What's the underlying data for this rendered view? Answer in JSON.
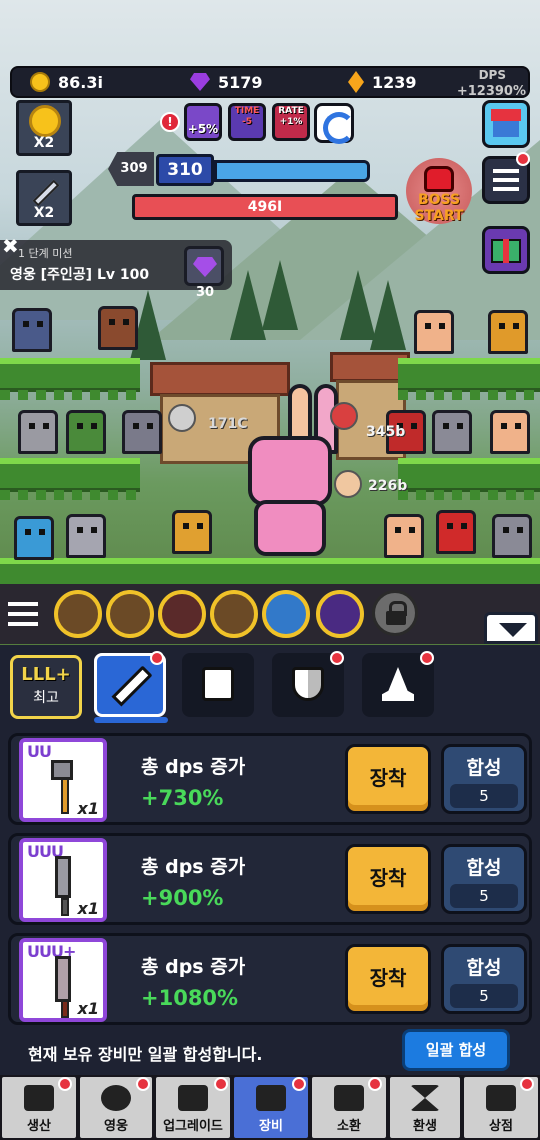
{
  "resources": {
    "coins": "86.3i",
    "gems": "5179",
    "gold": "1239",
    "dps_label": "DPS",
    "dps_value": "+12390%"
  },
  "side_buttons": {
    "coin_boost": "X2",
    "attack_boost": "X2"
  },
  "buffs": [
    {
      "label": "+5%",
      "icon": "sword-buff-icon"
    },
    {
      "label": "TIME -5",
      "icon": "time-buff-icon"
    },
    {
      "label": "RATE +1%",
      "icon": "rate-buff-icon"
    }
  ],
  "stage": {
    "previous": "309",
    "current": "310",
    "progress": 1.0
  },
  "enemy_hp": "496I",
  "boss_button": {
    "line1": "BOSS",
    "line2": "START"
  },
  "mission": {
    "subtitle": "1 단계 미션",
    "text": "영웅 [주인공] Lv 100",
    "reward": "30"
  },
  "damage_numbers": [
    "171C",
    "345b",
    "226b"
  ],
  "equipment": {
    "grade": {
      "label": "LLL+",
      "sub": "최고"
    },
    "categories": [
      "sword-icon",
      "armor-icon",
      "shield-icon",
      "hat-icon"
    ],
    "items": [
      {
        "tier": "UU",
        "qty": "x1",
        "title": "총 dps 증가",
        "value": "+730%",
        "equip": "장착",
        "merge": "합성",
        "merge_count": "5"
      },
      {
        "tier": "UUU",
        "qty": "x1",
        "title": "총 dps 증가",
        "value": "+900%",
        "equip": "장착",
        "merge": "합성",
        "merge_count": "5"
      },
      {
        "tier": "UUU+",
        "qty": "x1",
        "title": "총 dps 증가",
        "value": "+1080%",
        "equip": "장착",
        "merge": "합성",
        "merge_count": "5"
      }
    ],
    "footer_text": "현재 보유 장비만 일괄 합성합니다.",
    "bulk_button": "일괄 합성"
  },
  "nav": [
    {
      "label": "생산",
      "icon": "anvil-icon"
    },
    {
      "label": "영웅",
      "icon": "hero-icon"
    },
    {
      "label": "업그레이드",
      "icon": "upgrade-icon"
    },
    {
      "label": "장비",
      "icon": "bag-icon"
    },
    {
      "label": "소환",
      "icon": "summon-icon"
    },
    {
      "label": "환생",
      "icon": "hourglass-icon"
    },
    {
      "label": "상점",
      "icon": "cart-icon"
    }
  ],
  "colors": {
    "accent": "#2a67d6",
    "equip": "#f3b638",
    "stat_green": "#49d95a",
    "hp_red": "#e84f55"
  }
}
